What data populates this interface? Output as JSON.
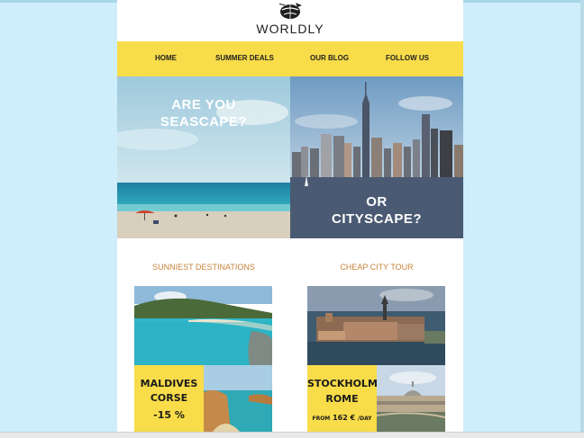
{
  "brand": {
    "name": "WORLDLY"
  },
  "nav": {
    "items": [
      "HOME",
      "SUMMER DEALS",
      "OUR BLOG",
      "FOLLOW US"
    ]
  },
  "hero": {
    "left": {
      "line1": "ARE YOU",
      "line2": "SEASCAPE?"
    },
    "right": {
      "line1": "OR",
      "line2": "CITYSCAPE?"
    }
  },
  "sections": {
    "left": {
      "title": "SUNNIEST DESTINATIONS",
      "line1": "MALDIVES",
      "line2": "CORSE",
      "line3": "-15 %"
    },
    "right": {
      "title": "CHEAP CITY TOUR",
      "line1": "STOCKHOLM",
      "line2": "ROME",
      "price_prefix": "FROM",
      "price": "162 €",
      "price_suffix": "/DAY"
    }
  },
  "colors": {
    "accent_yellow": "#f8dc49",
    "section_title": "#c8833a",
    "background": "#cdeefa"
  }
}
